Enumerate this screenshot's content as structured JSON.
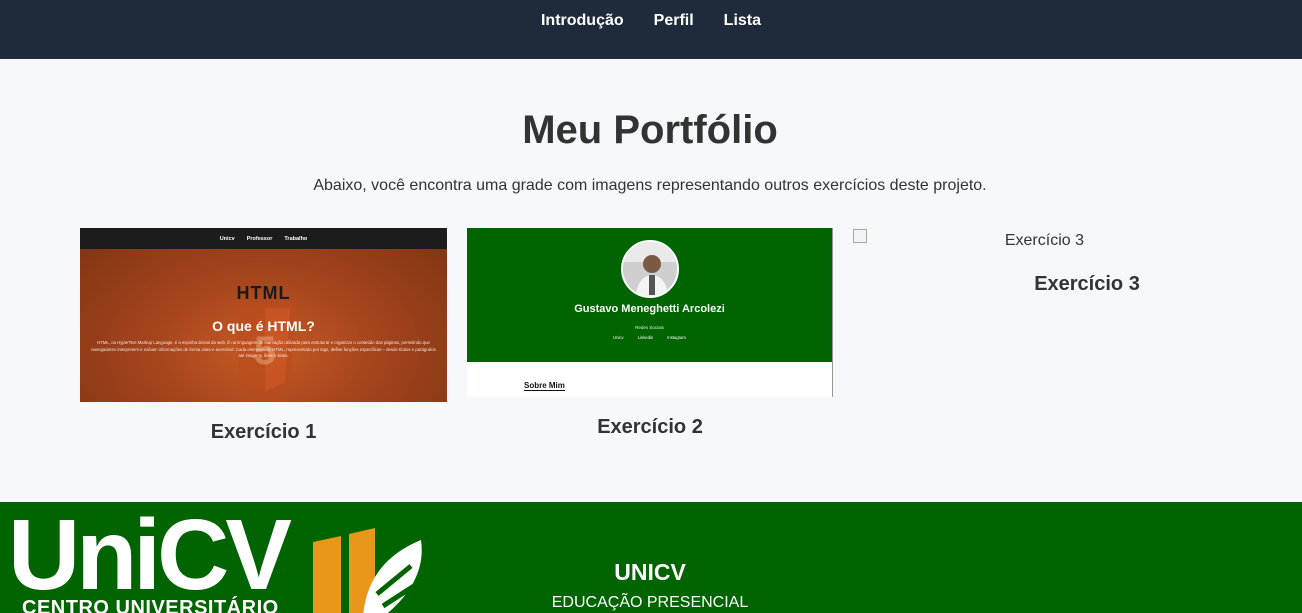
{
  "nav": {
    "items": [
      "Introdução",
      "Perfil",
      "Lista"
    ]
  },
  "main": {
    "title": "Meu Portfólio",
    "intro": "Abaixo, você encontra uma grade com imagens representando outros exercícios deste projeto."
  },
  "gallery": {
    "items": [
      {
        "caption": "Exercício 1",
        "thumb": {
          "nav": [
            "Unicv",
            "Professor",
            "Trabalho"
          ],
          "logo_text": "HTML",
          "heading": "O que é HTML?",
          "paragraph": "HTML, ou HyperText Markup Language, é a espinha dorsal da web. É na linguagem de marcação utilizada para estruturar e organizar o conteúdo das páginas, permitindo que navegadores interpretem e exibam informações de forma clara e acessível. Cada elemento do HTML, representado por tags, define funções específicas – desde títulos e parágrafos até imagens, links e listas."
        }
      },
      {
        "caption": "Exercício 2",
        "thumb": {
          "name": "Gustavo Meneghetti Arcolezi",
          "social_label": "Redes Sociais",
          "links": [
            "Unicv",
            "Linkedin",
            "Instagram"
          ],
          "section_title": "Sobre Mim"
        }
      },
      {
        "caption": "Exercício 3",
        "alt": "Exercício 3"
      }
    ]
  },
  "footer": {
    "logo_main": "UniCV",
    "logo_sub": "CENTRO UNIVERSITÁRIO",
    "title": "UNICV",
    "subtitle": "EDUCAÇÃO PRESENCIAL"
  },
  "colors": {
    "nav_bg": "#1f2a3a",
    "footer_bg": "#006400",
    "logo_accent": "#e8971b"
  }
}
